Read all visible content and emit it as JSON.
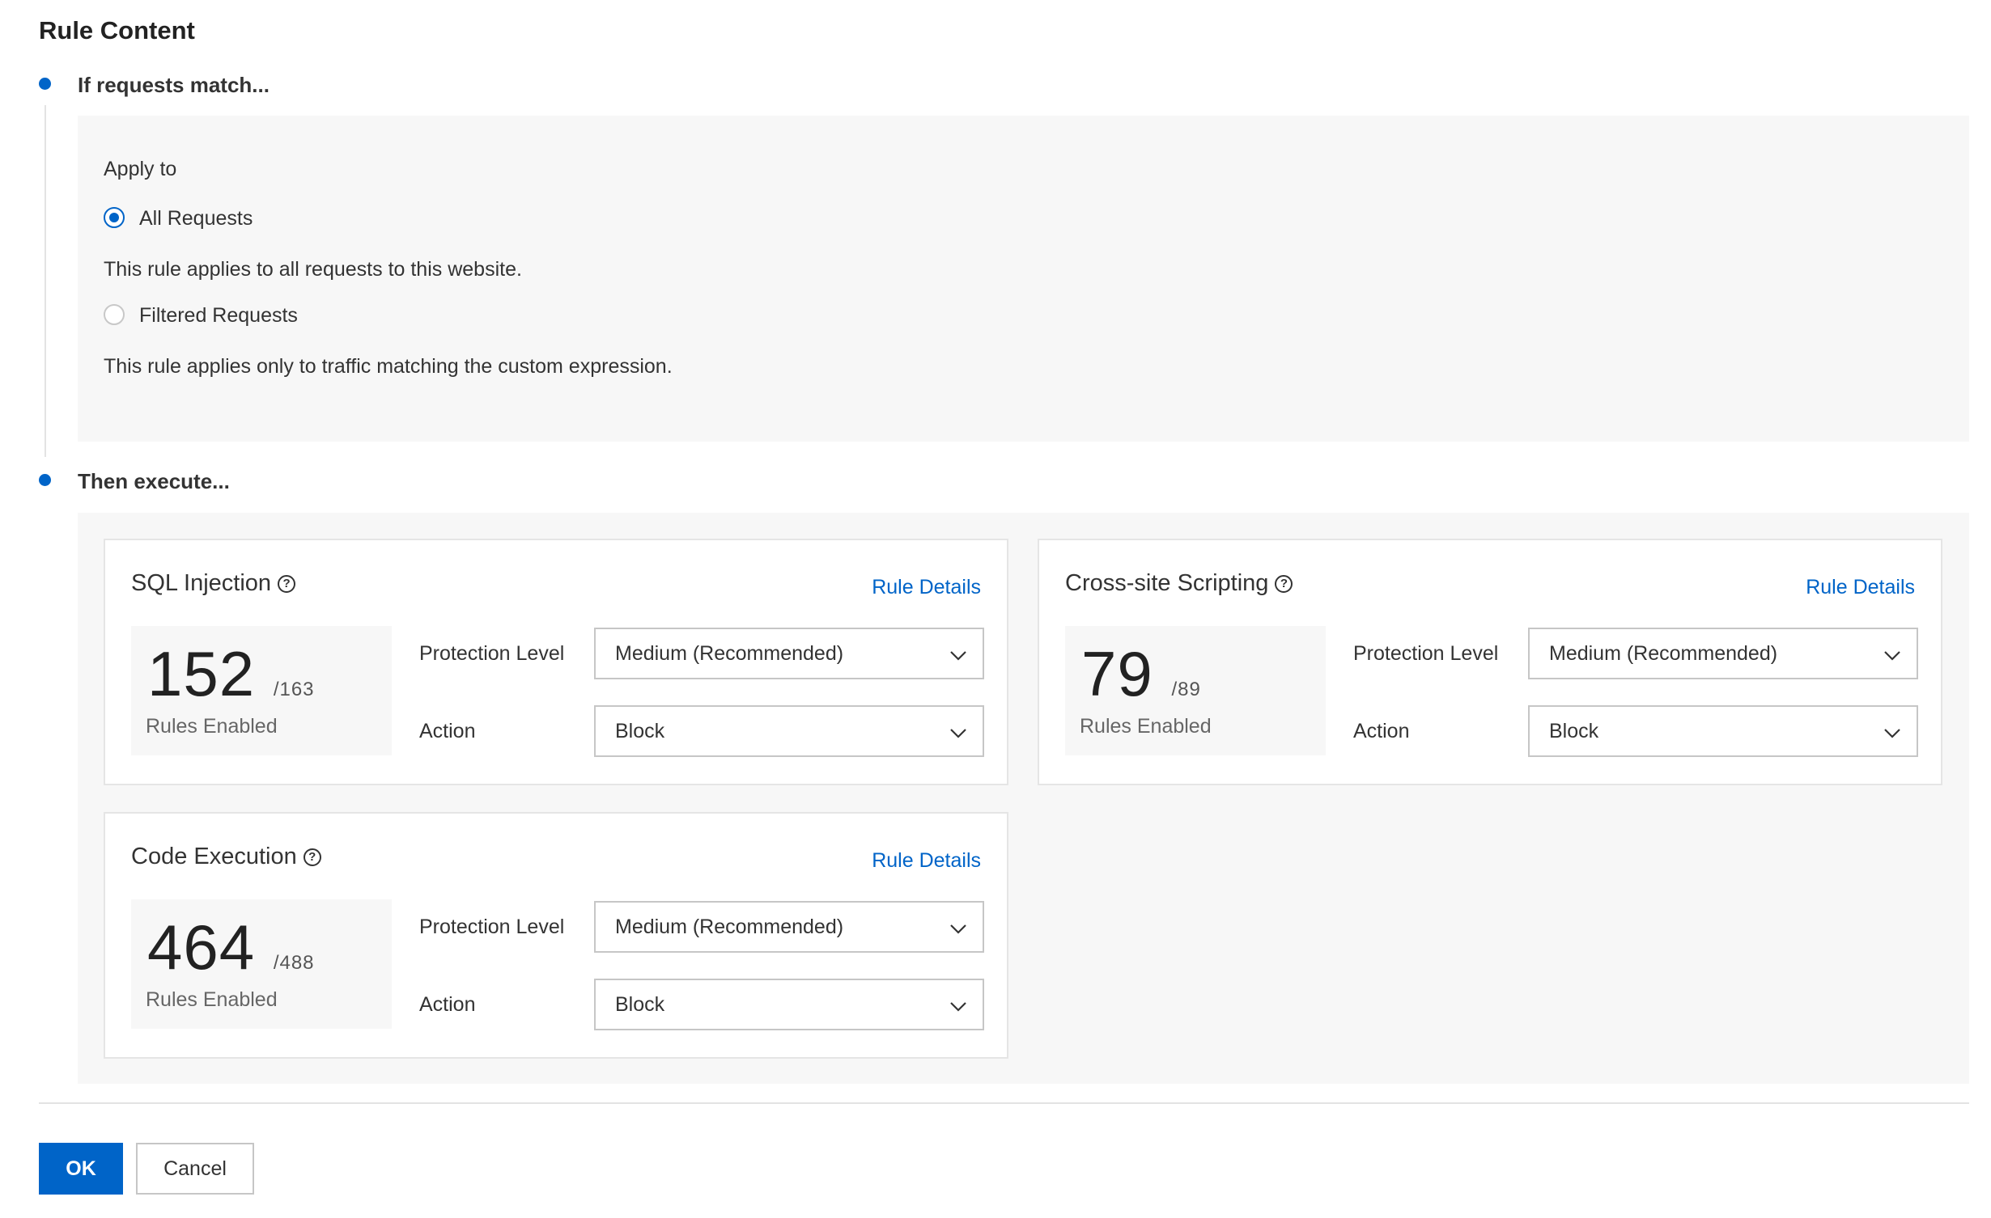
{
  "page": {
    "title": "Rule Content"
  },
  "steps": {
    "match_label": "If requests match...",
    "execute_label": "Then execute..."
  },
  "apply_to": {
    "label": "Apply to",
    "options": [
      {
        "label": "All Requests",
        "checked": true,
        "description": "This rule applies to all requests to this website."
      },
      {
        "label": "Filtered Requests",
        "checked": false,
        "description": "This rule applies only to traffic matching the custom expression."
      }
    ]
  },
  "cards": [
    {
      "title": "SQL Injection",
      "details_link": "Rule Details",
      "enabled": "152",
      "total": "/163",
      "enabled_label": "Rules Enabled",
      "protection_label": "Protection Level",
      "protection_value": "Medium (Recommended)",
      "action_label": "Action",
      "action_value": "Block"
    },
    {
      "title": "Cross-site Scripting",
      "details_link": "Rule Details",
      "enabled": "79",
      "total": "/89",
      "enabled_label": "Rules Enabled",
      "protection_label": "Protection Level",
      "protection_value": "Medium (Recommended)",
      "action_label": "Action",
      "action_value": "Block"
    },
    {
      "title": "Code Execution",
      "details_link": "Rule Details",
      "enabled": "464",
      "total": "/488",
      "enabled_label": "Rules Enabled",
      "protection_label": "Protection Level",
      "protection_value": "Medium (Recommended)",
      "action_label": "Action",
      "action_value": "Block"
    }
  ],
  "footer": {
    "ok_label": "OK",
    "cancel_label": "Cancel"
  },
  "colors": {
    "accent": "#0064c8",
    "panel_bg": "#f7f7f7"
  },
  "icons": {
    "help": "question-circle-icon",
    "dropdown": "chevron-down-icon"
  }
}
